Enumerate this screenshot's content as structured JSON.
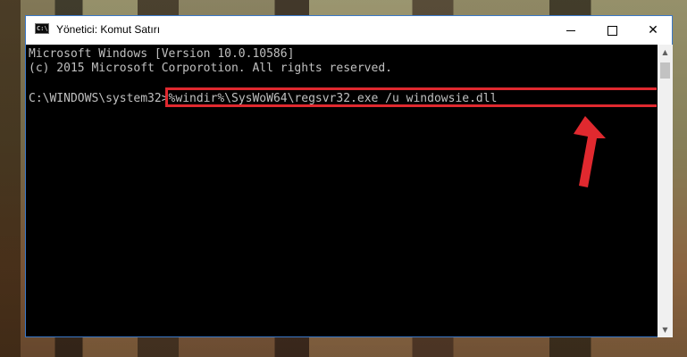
{
  "window": {
    "title": "Yönetici: Komut Satırı",
    "icon_label": "C:\\",
    "controls": [
      "minimize-icon",
      "maximize-icon",
      "close-icon"
    ]
  },
  "console": {
    "line1": "Microsoft Windows [Version 10.0.10586]",
    "line2": "(c) 2015 Microsoft Corporotion. All rights reserved.",
    "prompt": "C:\\WINDOWS\\system32>",
    "command": "%windir%\\SysWoW64\\regsvr32.exe /u windowsie.dll"
  },
  "annotation": {
    "highlight_color": "#e0292f",
    "arrow_color": "#e0292f"
  },
  "colors": {
    "console_bg": "#000000",
    "console_text": "#c0c0c0",
    "title_bg": "#ffffff"
  }
}
